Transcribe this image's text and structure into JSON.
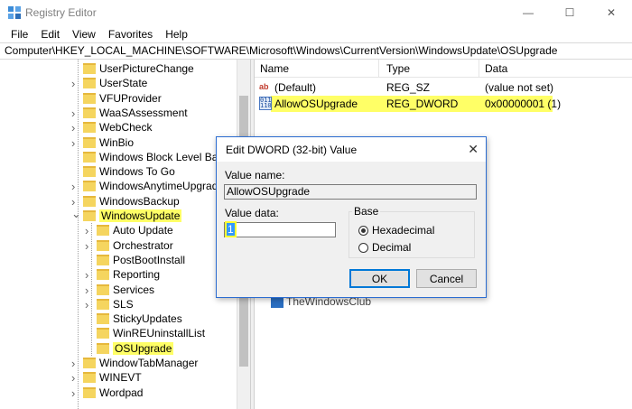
{
  "window": {
    "title": "Registry Editor",
    "minimize": "—",
    "maximize": "☐",
    "close": "✕"
  },
  "menu": [
    "File",
    "Edit",
    "View",
    "Favorites",
    "Help"
  ],
  "address": "Computer\\HKEY_LOCAL_MACHINE\\SOFTWARE\\Microsoft\\Windows\\CurrentVersion\\WindowsUpdate\\OSUpgrade",
  "tree": {
    "items": [
      {
        "label": "UserPictureChange",
        "level": 1,
        "chevron": false
      },
      {
        "label": "UserState",
        "level": 1,
        "chevron": true
      },
      {
        "label": "VFUProvider",
        "level": 1,
        "chevron": false
      },
      {
        "label": "WaaSAssessment",
        "level": 1,
        "chevron": true
      },
      {
        "label": "WebCheck",
        "level": 1,
        "chevron": true
      },
      {
        "label": "WinBio",
        "level": 1,
        "chevron": true
      },
      {
        "label": "Windows Block Level Backu",
        "level": 1,
        "chevron": false
      },
      {
        "label": "Windows To Go",
        "level": 1,
        "chevron": false
      },
      {
        "label": "WindowsAnytimeUpgrade",
        "level": 1,
        "chevron": true
      },
      {
        "label": "WindowsBackup",
        "level": 1,
        "chevron": true
      },
      {
        "label": "WindowsUpdate",
        "level": 1,
        "chevron": "open",
        "highlight": true
      },
      {
        "label": "Auto Update",
        "level": 2,
        "chevron": true
      },
      {
        "label": "Orchestrator",
        "level": 2,
        "chevron": true
      },
      {
        "label": "PostBootInstall",
        "level": 2,
        "chevron": false
      },
      {
        "label": "Reporting",
        "level": 2,
        "chevron": true
      },
      {
        "label": "Services",
        "level": 2,
        "chevron": true
      },
      {
        "label": "SLS",
        "level": 2,
        "chevron": true
      },
      {
        "label": "StickyUpdates",
        "level": 2,
        "chevron": false
      },
      {
        "label": "WinREUninstallList",
        "level": 2,
        "chevron": false
      },
      {
        "label": "OSUpgrade",
        "level": 2,
        "chevron": false,
        "highlight": true
      },
      {
        "label": "WindowTabManager",
        "level": 1,
        "chevron": true
      },
      {
        "label": "WINEVT",
        "level": 1,
        "chevron": true
      },
      {
        "label": "Wordpad",
        "level": 1,
        "chevron": true
      }
    ]
  },
  "list": {
    "headers": {
      "name": "Name",
      "type": "Type",
      "data": "Data"
    },
    "rows": [
      {
        "icon": "ab",
        "name": "(Default)",
        "type": "REG_SZ",
        "data": "(value not set)",
        "highlight": false
      },
      {
        "icon": "binary",
        "name": "AllowOSUpgrade",
        "type": "REG_DWORD",
        "data": "0x00000001 (1)",
        "highlight": true
      }
    ],
    "icon_text": {
      "ab": "ab",
      "binary": "011 110"
    }
  },
  "watermark": "TheWindowsClub",
  "dialog": {
    "title": "Edit DWORD (32-bit) Value",
    "close": "✕",
    "value_name_label": "Value name:",
    "value_name": "AllowOSUpgrade",
    "value_data_label": "Value data:",
    "value_data": "1",
    "base_label": "Base",
    "hex_label": "Hexadecimal",
    "dec_label": "Decimal",
    "ok_label": "OK",
    "cancel_label": "Cancel"
  },
  "colors": {
    "highlight": "#ffff66",
    "folder": "#f5d55f",
    "dialog_border": "#2b6cd1",
    "selection": "#3399ff"
  }
}
